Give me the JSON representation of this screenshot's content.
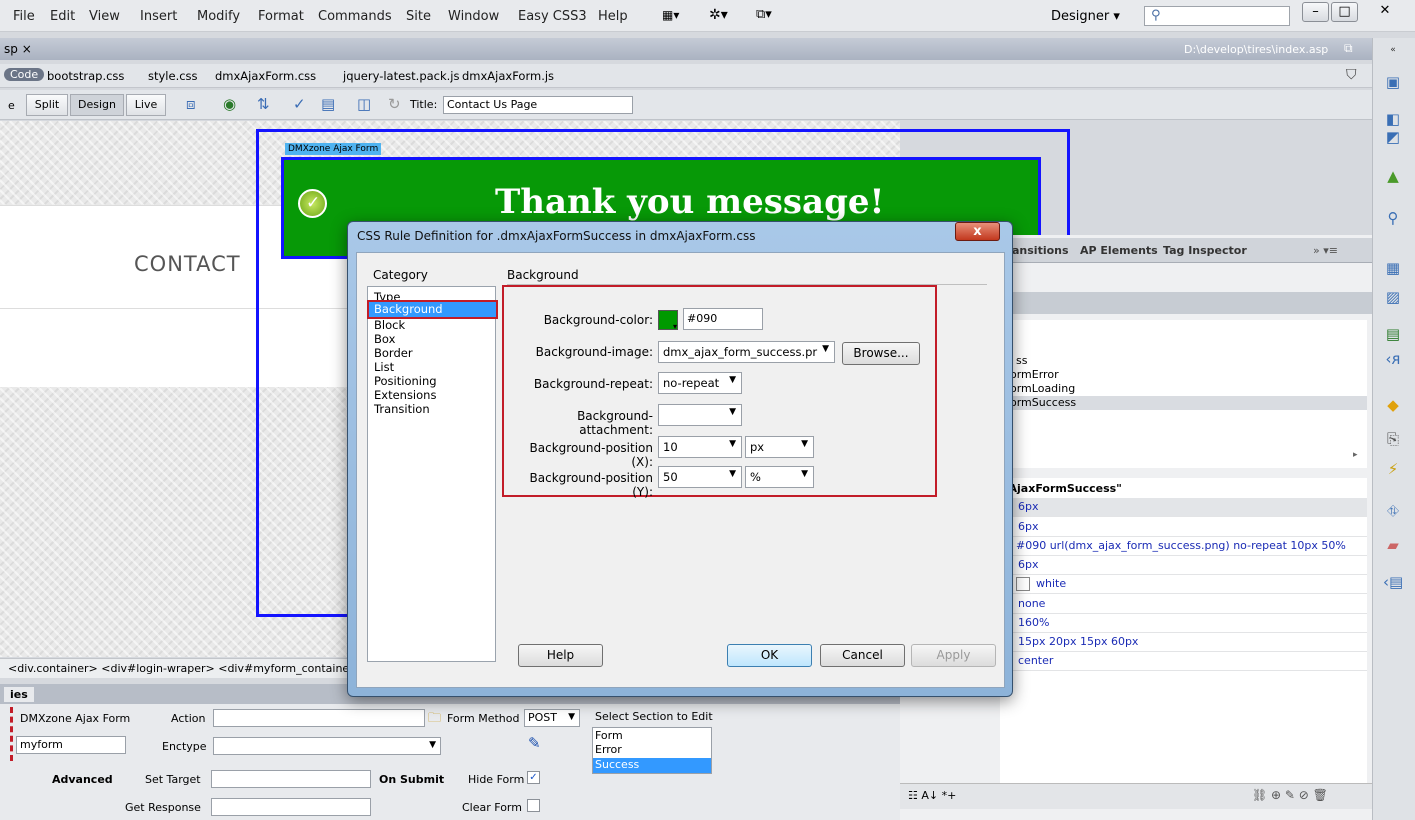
{
  "menubar": {
    "items": [
      "File",
      "Edit",
      "View",
      "Insert",
      "Modify",
      "Format",
      "Commands",
      "Site",
      "Window",
      "Easy CSS3",
      "Help"
    ],
    "workspace": "Designer",
    "workspace_arrow": "▾"
  },
  "doc_tab": {
    "name": "sp",
    "close": "×",
    "path": "D:\\develop\\tires\\index.asp"
  },
  "related_files": {
    "code_label": "Code",
    "files": [
      "bootstrap.css",
      "style.css",
      "dmxAjaxForm.css",
      "jquery-latest.pack.js",
      "dmxAjaxForm.js"
    ]
  },
  "doc_toolbar": {
    "split": "Split",
    "design": "Design",
    "live": "Live",
    "title_label": "Title:",
    "title_value": "Contact Us Page"
  },
  "design": {
    "contact_heading": "CONTACT",
    "form_label": "DMXzone Ajax Form",
    "thank_you": "Thank you message!"
  },
  "tag_selector": "<div.container> <div#login-wraper> <div#myform_container",
  "inspector": {
    "header": "ies",
    "form_type": "DMXzone Ajax Form",
    "form_id": "myform",
    "action_label": "Action",
    "enctype_label": "Enctype",
    "form_method_label": "Form Method",
    "form_method_value": "POST",
    "select_section_label": "Select Section to Edit",
    "sections": [
      "Form",
      "Error",
      "Success"
    ],
    "selected_section": "Success",
    "advanced": "Advanced",
    "set_target": "Set Target",
    "get_response": "Get Response",
    "on_submit": "On Submit",
    "hide_form": "Hide Form",
    "hide_form_checked": "✓",
    "clear_form": "Clear Form"
  },
  "right_panel": {
    "tabs": [
      "ansitions",
      "AP Elements",
      "Tag Inspector"
    ],
    "rules": [
      "ss",
      "ormError",
      "ormLoading",
      "ormSuccess"
    ],
    "props_title": "cAjaxFormSuccess\"",
    "props": [
      "6px",
      "6px",
      "#090 url(dmx_ajax_form_success.png) no-repeat 10px 50%",
      "6px",
      "white",
      "none",
      "160%",
      "15px 20px 15px 60px",
      "center"
    ]
  },
  "dialog": {
    "title": "CSS Rule Definition for .dmxAjaxFormSuccess in dmxAjaxForm.css",
    "close": "x",
    "category_heading": "Category",
    "categories": [
      "Type",
      "Background",
      "Block",
      "Box",
      "Border",
      "List",
      "Positioning",
      "Extensions",
      "Transition"
    ],
    "selected_category": "Background",
    "section_heading": "Background",
    "fields": {
      "bg_color_label": "Background-color:",
      "bg_color_value": "#090",
      "bg_color_swatch": "#009900",
      "bg_image_label": "Background-image:",
      "bg_image_value": "dmx_ajax_form_success.pr",
      "browse": "Browse...",
      "bg_repeat_label": "Background-repeat:",
      "bg_repeat_value": "no-repeat",
      "bg_attachment_label": "Background-attachment:",
      "bg_attachment_value": "",
      "bg_pos_x_label": "Background-position (X):",
      "bg_pos_x_value": "10",
      "bg_pos_x_unit": "px",
      "bg_pos_y_label": "Background-position (Y):",
      "bg_pos_y_value": "50",
      "bg_pos_y_unit": "%"
    },
    "buttons": {
      "help": "Help",
      "ok": "OK",
      "cancel": "Cancel",
      "apply": "Apply"
    }
  },
  "colors": {
    "accent_blue": "#1414ff",
    "form_green": "#079907",
    "highlight": "#3399ff",
    "annotation_red": "#c21c28"
  }
}
